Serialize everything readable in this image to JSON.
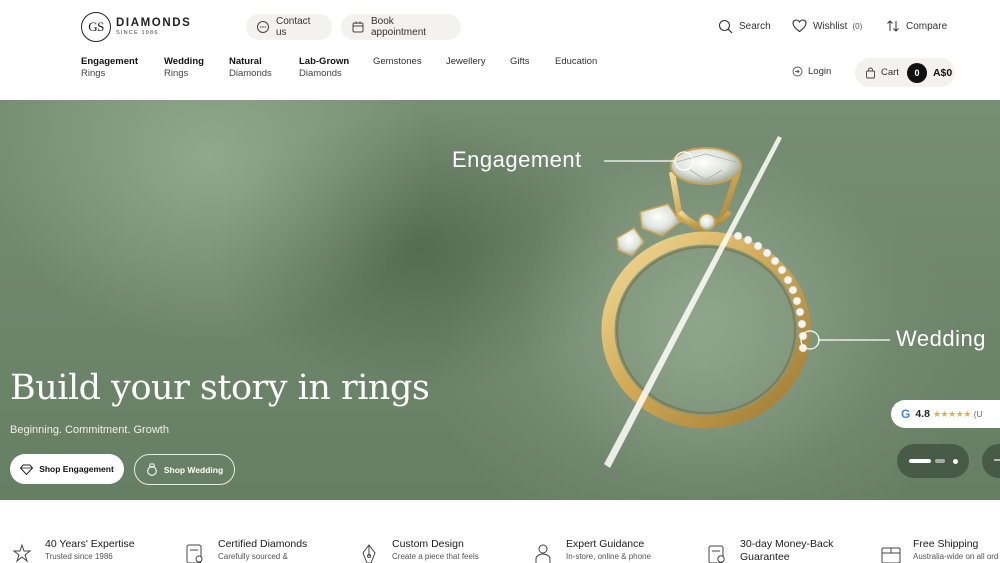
{
  "brand": {
    "logo_initials": "GS",
    "name": "DIAMONDS",
    "since": "SINCE 1986"
  },
  "header": {
    "contact_label": "Contact us",
    "book_label": "Book appointment",
    "search_label": "Search",
    "wishlist_label": "Wishlist",
    "wishlist_count": "(0)",
    "compare_label": "Compare",
    "login_label": "Login",
    "cart_label": "Cart",
    "cart_count": "0",
    "cart_total": "A$0"
  },
  "nav": {
    "items": [
      {
        "line1": "Engagement",
        "line2": "Rings"
      },
      {
        "line1": "Wedding",
        "line2": "Rings"
      },
      {
        "line1": "Natural",
        "line2": "Diamonds"
      },
      {
        "line1": "Lab-Grown",
        "line2": "Diamonds"
      },
      {
        "line1": "Gemstones",
        "line2": ""
      },
      {
        "line1": "Jewellery",
        "line2": ""
      },
      {
        "line1": "Gifts",
        "line2": ""
      },
      {
        "line1": "Education",
        "line2": ""
      }
    ]
  },
  "hero": {
    "title": "Build your story in rings",
    "subtitle": "Beginning. Commitment. Growth",
    "shop_engagement": "Shop Engagement",
    "shop_wedding": "Shop Wedding",
    "label_engagement": "Engagement",
    "label_wedding": "Wedding",
    "rating_source_letter": "G",
    "rating_value": "4.8",
    "rating_stars": "★★★★★",
    "rating_suffix": "(U",
    "rating_fraction": 0.96,
    "slides_total": 2,
    "slide_current": 1
  },
  "features": [
    {
      "title": "40 Years' Expertise",
      "desc": "Trusted since 1986",
      "icon": "diamond-star-icon"
    },
    {
      "title": "Certified Diamonds",
      "desc": "Carefully sourced &",
      "icon": "certificate-icon"
    },
    {
      "title": "Custom Design",
      "desc": "Create a piece that feels",
      "icon": "pen-nib-icon"
    },
    {
      "title": "Expert Guidance",
      "desc": "In-store, online & phone",
      "icon": "person-icon"
    },
    {
      "title": "30-day Money-Back",
      "desc": "Guarantee",
      "icon": "money-back-icon"
    },
    {
      "title": "Free Shipping",
      "desc": "Australia-wide on all ord",
      "icon": "box-icon"
    }
  ],
  "colors": {
    "hero_bg": "#6d856a",
    "ring_gold": "#d8b56a",
    "accent_dark": "#111111"
  }
}
